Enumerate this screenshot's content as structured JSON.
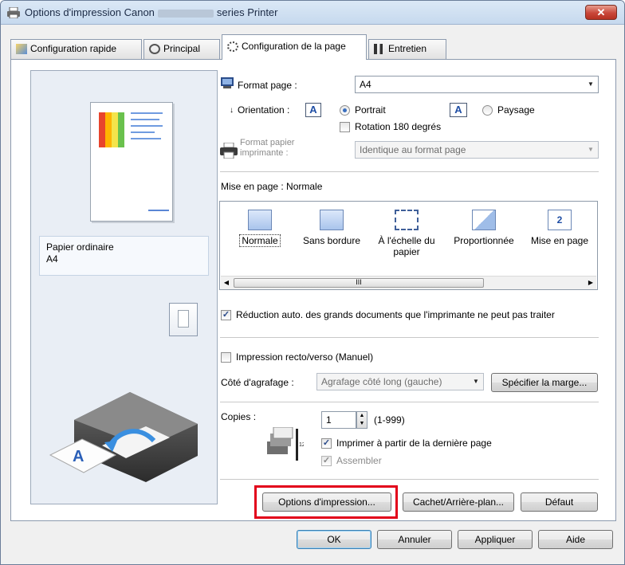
{
  "window": {
    "title_prefix": "Options d'impression Canon",
    "title_suffix": "series Printer",
    "close_label": "✕"
  },
  "tabs": [
    {
      "label": "Configuration rapide",
      "icon": "quick-setup-icon"
    },
    {
      "label": "Principal",
      "icon": "main-icon"
    },
    {
      "label": "Configuration de la page",
      "icon": "page-setup-icon"
    },
    {
      "label": "Entretien",
      "icon": "maintenance-icon"
    }
  ],
  "preview": {
    "media_line1": "Papier ordinaire",
    "media_line2": "A4"
  },
  "page_size": {
    "label": "Format page :",
    "value": "A4"
  },
  "orientation": {
    "label": "Orientation :",
    "portrait": "Portrait",
    "landscape": "Paysage",
    "selected": "portrait",
    "rotate_label": "Rotation 180 degrés",
    "rotate_checked": false
  },
  "printer_paper": {
    "label_line1": "Format papier",
    "label_line2": "imprimante :",
    "value": "Identique au format page"
  },
  "page_layout": {
    "label": "Mise en page : Normale",
    "items": [
      {
        "label": "Normale",
        "selected": true
      },
      {
        "label": "Sans bordure",
        "selected": false
      },
      {
        "label": "À l'échelle du papier",
        "selected": false
      },
      {
        "label": "Proportionnée",
        "selected": false
      },
      {
        "label": "Mise en page",
        "selected": false
      }
    ],
    "scroll_grip": "III"
  },
  "auto_reduce": {
    "label": "Réduction auto. des grands documents que l'imprimante ne peut pas traiter",
    "checked": true
  },
  "duplex": {
    "label": "Impression recto/verso (Manuel)",
    "checked": false
  },
  "stapling": {
    "label": "Côté d'agrafage :",
    "value": "Agrafage côté long (gauche)",
    "margin_button": "Spécifier la marge..."
  },
  "copies": {
    "label": "Copies :",
    "value": "1",
    "range": "(1-999)",
    "last_page_label": "Imprimer à partir de la dernière page",
    "last_page_checked": true,
    "collate_label": "Assembler",
    "collate_checked": true
  },
  "buttons": {
    "print_options": "Options d'impression...",
    "stamp": "Cachet/Arrière-plan...",
    "defaults": "Défaut",
    "ok": "OK",
    "cancel": "Annuler",
    "apply": "Appliquer",
    "help": "Aide"
  },
  "colors": {
    "highlight": "#e2001a",
    "accent": "#3a6fbf"
  }
}
